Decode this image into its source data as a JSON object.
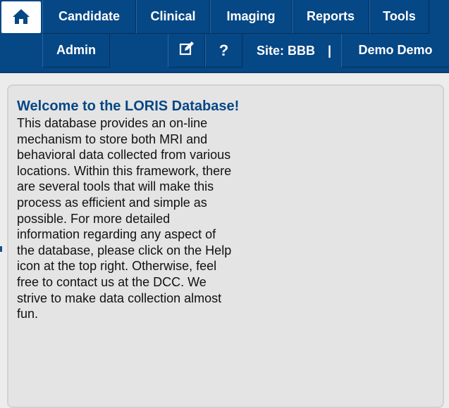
{
  "nav": {
    "home_label": "Home",
    "row1": [
      "Candidate",
      "Clinical",
      "Imaging",
      "Reports",
      "Tools"
    ],
    "admin": "Admin",
    "help": "?",
    "site": "Site: BBB",
    "separator": "|",
    "user": "Demo Demo"
  },
  "welcome": {
    "title": "Welcome to the LORIS Database!",
    "body": "This database provides an on-line mechanism to store both MRI and behavioral data collected from various locations. Within this framework, there are several tools that will make this process as efficient and simple as possible. For more detailed information regarding any aspect of the database, please click on the Help icon at the top right. Otherwise, feel free to contact us at the DCC. We strive to make data collection almost fun."
  },
  "colors": {
    "navbar": "#064785",
    "title": "#064785",
    "panel": "#e4e4e4"
  },
  "icons": {
    "home": "home-icon",
    "edit": "edit-icon"
  }
}
